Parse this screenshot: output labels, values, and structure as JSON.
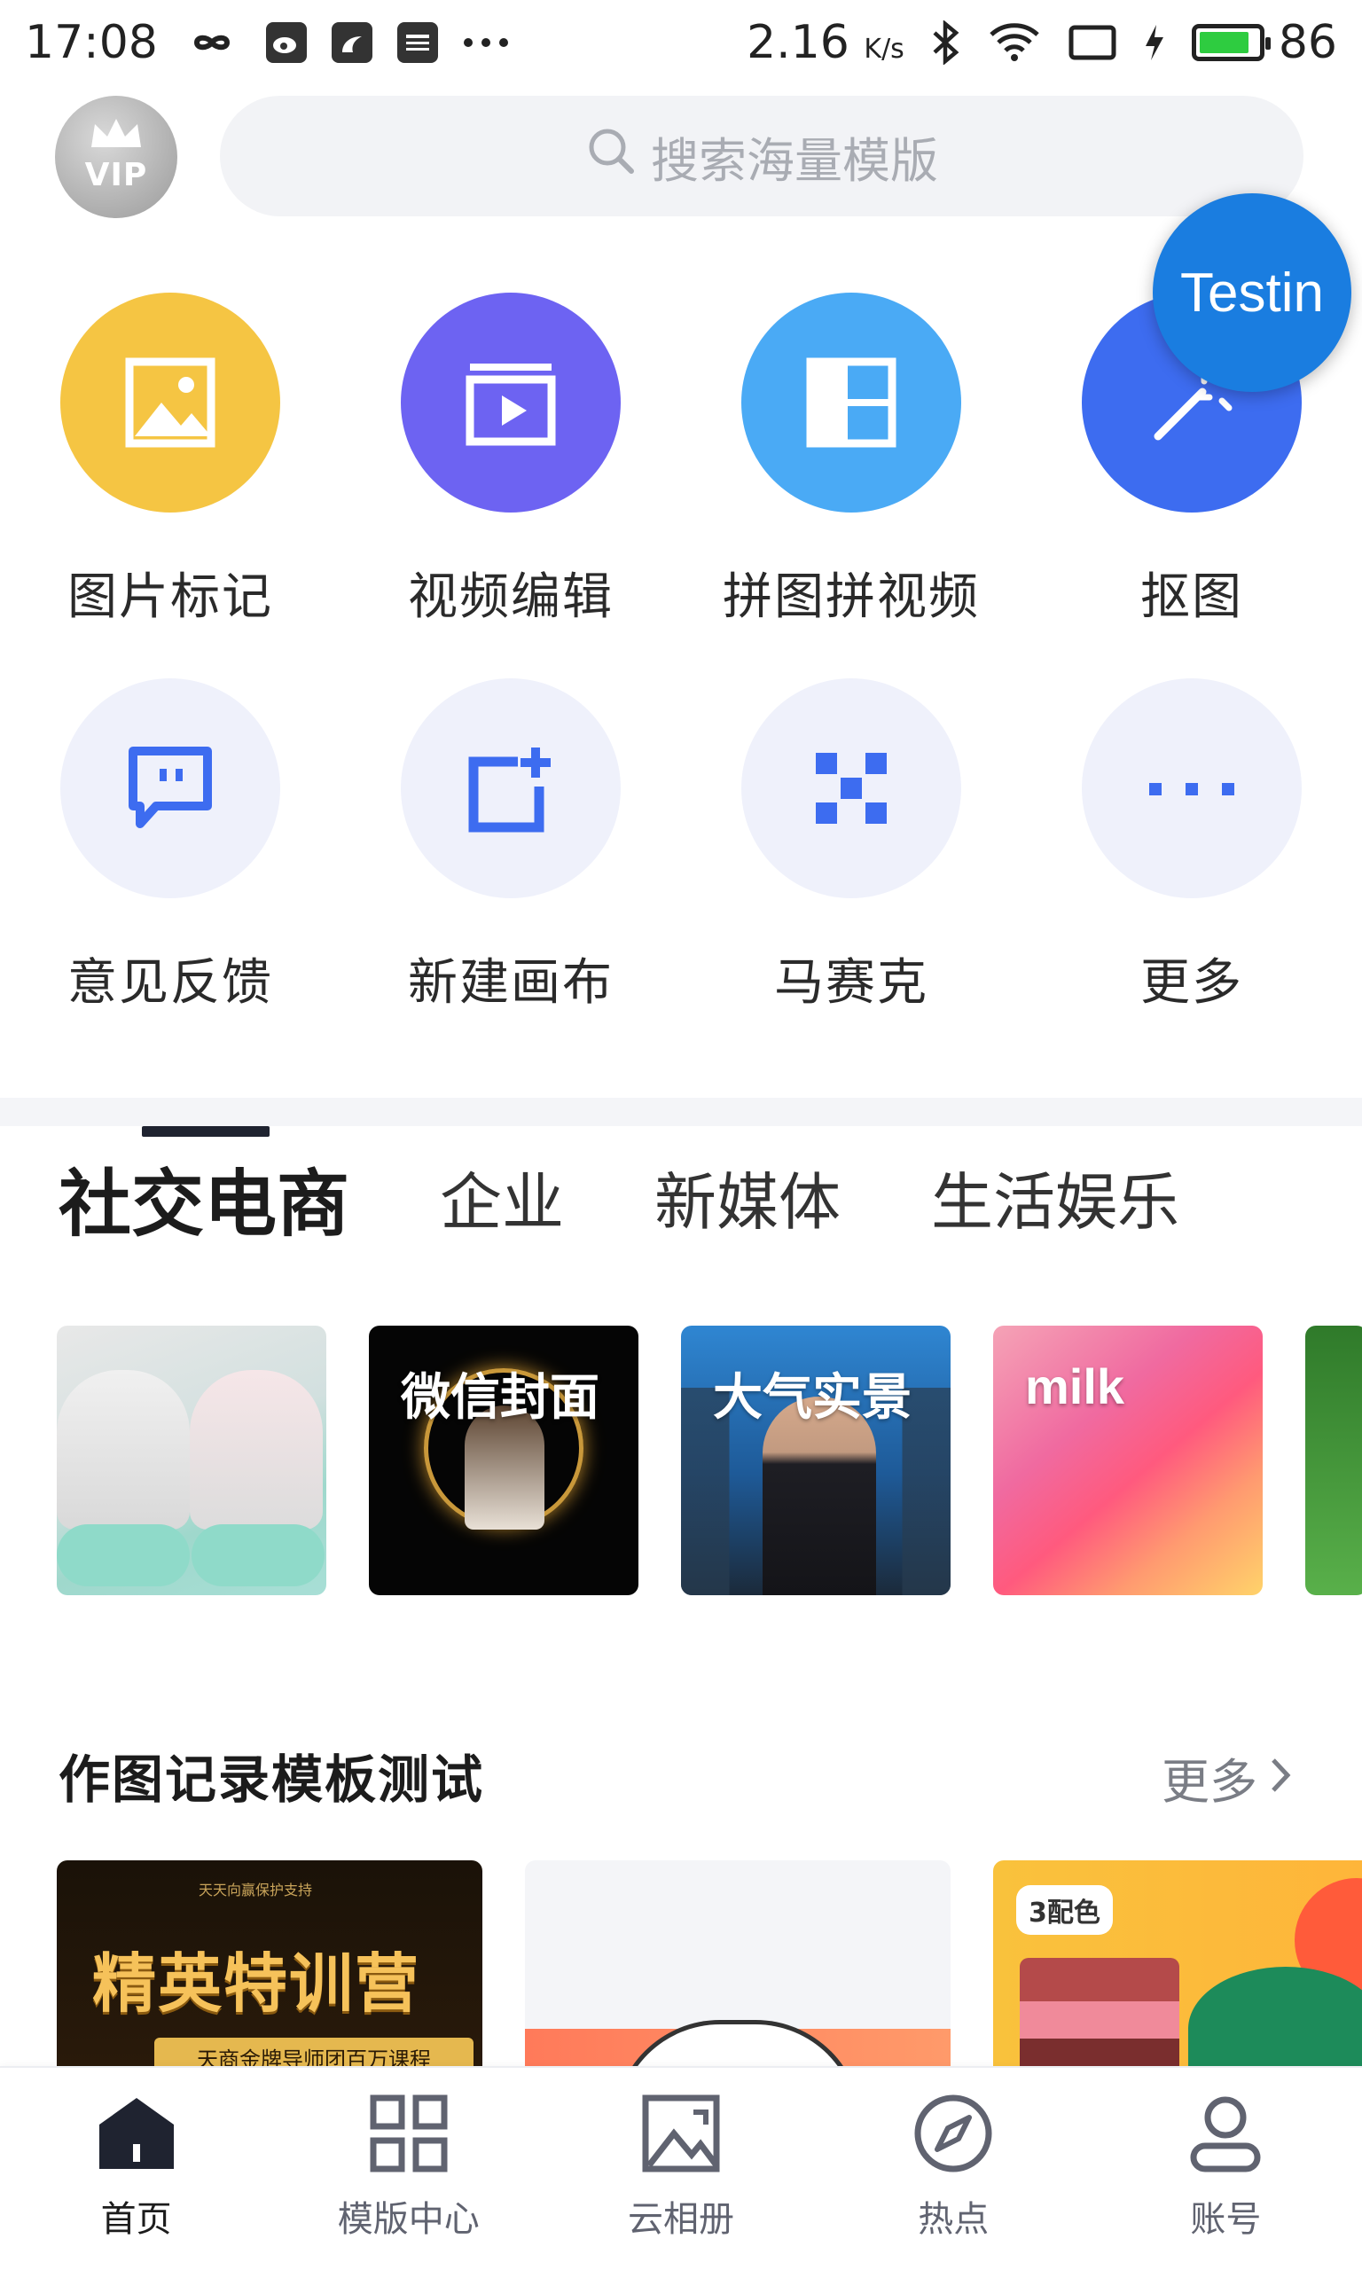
{
  "status_bar": {
    "time": "17:08",
    "speed": "2.16",
    "speed_unit": "K/s",
    "battery_level": "86",
    "battery_fraction": 0.86,
    "notification_icons": [
      "infinity-icon",
      "weibo-icon",
      "uc-browser-icon",
      "news-icon",
      "more-dots-icon"
    ],
    "system_icons": [
      "bluetooth-icon",
      "wifi-icon",
      "screen-rotation-icon",
      "charging-icon",
      "battery-icon"
    ]
  },
  "header": {
    "vip_label": "VIP",
    "search_placeholder": "搜索海量模版",
    "floating_badge": "Testin"
  },
  "tools": [
    {
      "label": "图片标记",
      "icon": "image-mark-icon",
      "color": "#f5c543"
    },
    {
      "label": "视频编辑",
      "icon": "video-edit-icon",
      "color": "#6d63f2"
    },
    {
      "label": "拼图拼视频",
      "icon": "collage-icon",
      "color": "#4aaaf5"
    },
    {
      "label": "抠图",
      "icon": "magic-wand-icon",
      "color": "#3d6cf0"
    },
    {
      "label": "意见反馈",
      "icon": "feedback-icon",
      "color": "#eff1fb"
    },
    {
      "label": "新建画布",
      "icon": "new-canvas-icon",
      "color": "#eff1fb"
    },
    {
      "label": "马赛克",
      "icon": "mosaic-icon",
      "color": "#eff1fb"
    },
    {
      "label": "更多",
      "icon": "more-icon",
      "color": "#eff1fb"
    }
  ],
  "category_tabs": [
    {
      "label": "社交电商",
      "active": true
    },
    {
      "label": "企业",
      "active": false
    },
    {
      "label": "新媒体",
      "active": false
    },
    {
      "label": "生活娱乐",
      "active": false
    }
  ],
  "templates": [
    {
      "title": ""
    },
    {
      "title": "微信封面"
    },
    {
      "title": "大气实景"
    },
    {
      "title": "milk"
    },
    {
      "title": ""
    }
  ],
  "record_section": {
    "title": "作图记录模板测试",
    "more_label": "更多",
    "cards": [
      {
        "top_text": "天天向赢保护支持",
        "title": "精英特训营",
        "subtitle": "天商金牌导师团百万课程"
      },
      {
        "title": ""
      },
      {
        "badge": "3配色"
      }
    ]
  },
  "bottom_nav": [
    {
      "label": "首页",
      "icon": "home-icon",
      "active": true
    },
    {
      "label": "模版中心",
      "icon": "grid-icon",
      "active": false
    },
    {
      "label": "云相册",
      "icon": "album-icon",
      "active": false
    },
    {
      "label": "热点",
      "icon": "compass-icon",
      "active": false
    },
    {
      "label": "账号",
      "icon": "user-icon",
      "active": false
    }
  ],
  "colors": {
    "accent_dark": "#1f2330",
    "nav_inactive": "#606370",
    "search_bg": "#f2f3f6"
  }
}
